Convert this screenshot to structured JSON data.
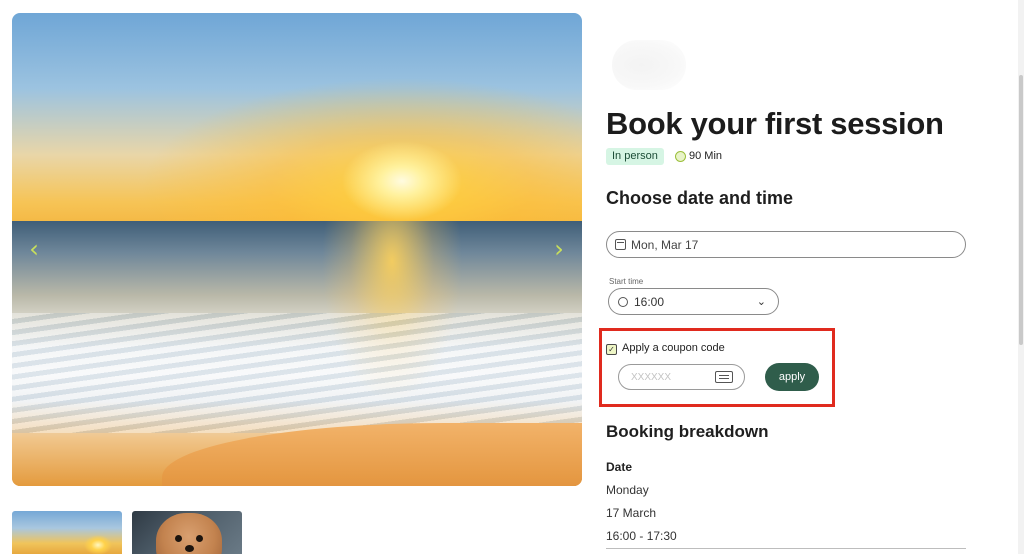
{
  "gallery": {
    "prev_icon": "chevron-left-icon",
    "next_icon": "chevron-right-icon",
    "prev_glyph": "‹",
    "next_glyph": "›"
  },
  "header": {
    "title": "Book your first session",
    "badge": "In person",
    "duration": "90 Min"
  },
  "scheduler": {
    "section_title": "Choose date and time",
    "date_value": "Mon, Mar 17",
    "start_time_label": "Start time",
    "start_time_value": "16:00"
  },
  "coupon": {
    "checkbox_label": "Apply a coupon code",
    "checked": true,
    "placeholder": "XXXXXX",
    "apply_label": "apply"
  },
  "breakdown": {
    "title": "Booking breakdown",
    "date_label": "Date",
    "day": "Monday",
    "date": "17 March",
    "time_range": "16:00 - 17:30"
  },
  "colors": {
    "accent_button": "#2f5d4b",
    "badge_bg": "#d6f5e4",
    "highlight": "#e02a1e",
    "arrow": "#c9e05a"
  }
}
